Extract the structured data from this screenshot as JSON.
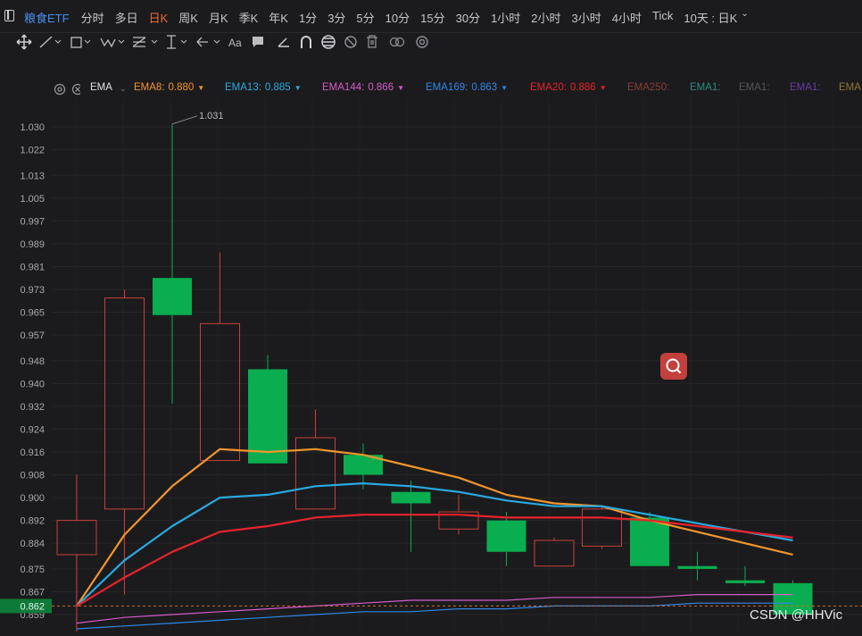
{
  "header": {
    "symbol": "粮食ETF",
    "periods": [
      "分时",
      "多日",
      "日K",
      "周K",
      "月K",
      "季K",
      "年K",
      "1分",
      "3分",
      "5分",
      "10分",
      "15分",
      "30分",
      "1小时",
      "2小时",
      "3小时",
      "4小时",
      "Tick"
    ],
    "active_period": "日K",
    "range_label": "10天 : 日K"
  },
  "toolbar": {
    "icons": [
      "move-icon",
      "line-icon",
      "rect-icon",
      "wave-icon",
      "fib-icon",
      "vertical-ruler-icon",
      "arrow-icon",
      "text-icon",
      "comment-icon",
      "angle-icon",
      "magnet-icon",
      "eye-icon",
      "hide-icon",
      "trash-icon",
      "link-icon",
      "settings-icon"
    ],
    "text_tool_label": "Aa"
  },
  "indicator_legend": {
    "name": "EMA",
    "items": [
      {
        "label": "EMA8:",
        "value": "0.880",
        "color": "#f2952d",
        "has_arrow": true
      },
      {
        "label": "EMA13:",
        "value": "0.885",
        "color": "#2aa9e0",
        "has_arrow": true
      },
      {
        "label": "EMA144:",
        "value": "0.866",
        "color": "#d65bc9",
        "has_arrow": true
      },
      {
        "label": "EMA169:",
        "value": "0.863",
        "color": "#2f86e8",
        "has_arrow": true
      },
      {
        "label": "EMA20:",
        "value": "0.886",
        "color": "#e8232b",
        "has_arrow": true
      },
      {
        "label": "EMA250:",
        "value": "",
        "color": "#8a3a36",
        "has_arrow": false
      },
      {
        "label": "EMA1:",
        "value": "",
        "color": "#2e8a86",
        "has_arrow": false
      },
      {
        "label": "EMA1:",
        "value": "",
        "color": "#55555a",
        "has_arrow": false
      },
      {
        "label": "EMA1:",
        "value": "",
        "color": "#6a3aa8",
        "has_arrow": false
      },
      {
        "label": "EMA1:",
        "value": "",
        "color": "#8a7a2e",
        "has_arrow": false
      }
    ]
  },
  "chart_data": {
    "type": "candlestick",
    "y_ticks": [
      1.03,
      1.022,
      1.013,
      1.005,
      0.997,
      0.989,
      0.981,
      0.973,
      0.965,
      0.957,
      0.948,
      0.94,
      0.932,
      0.924,
      0.916,
      0.908,
      0.9,
      0.892,
      0.884,
      0.875,
      0.867,
      0.859
    ],
    "y_tick_labels": [
      "1.030",
      "1.022",
      "1.013",
      "1.005",
      "0.997",
      "0.989",
      "0.981",
      "0.973",
      "0.965",
      "0.957",
      "0.948",
      "0.940",
      "0.932",
      "0.924",
      "0.916",
      "0.908",
      "0.900",
      "0.892",
      "0.884",
      "0.875",
      "0.867",
      "0.859"
    ],
    "current_price_label": "0.862",
    "current_price": 0.862,
    "high_annotation": "1.031",
    "candles": [
      {
        "open": 0.88,
        "close": 0.892,
        "high": 0.908,
        "low": 0.847
      },
      {
        "open": 0.896,
        "close": 0.97,
        "high": 0.973,
        "low": 0.866
      },
      {
        "open": 0.977,
        "close": 0.964,
        "high": 1.031,
        "low": 0.933
      },
      {
        "open": 0.913,
        "close": 0.961,
        "high": 0.986,
        "low": 0.913
      },
      {
        "open": 0.945,
        "close": 0.912,
        "high": 0.95,
        "low": 0.912
      },
      {
        "open": 0.896,
        "close": 0.921,
        "high": 0.931,
        "low": 0.896
      },
      {
        "open": 0.915,
        "close": 0.908,
        "high": 0.919,
        "low": 0.903
      },
      {
        "open": 0.902,
        "close": 0.898,
        "high": 0.906,
        "low": 0.881
      },
      {
        "open": 0.889,
        "close": 0.895,
        "high": 0.901,
        "low": 0.887
      },
      {
        "open": 0.892,
        "close": 0.881,
        "high": 0.895,
        "low": 0.876
      },
      {
        "open": 0.876,
        "close": 0.885,
        "high": 0.886,
        "low": 0.876
      },
      {
        "open": 0.883,
        "close": 0.896,
        "high": 0.897,
        "low": 0.882
      },
      {
        "open": 0.893,
        "close": 0.876,
        "high": 0.895,
        "low": 0.876
      },
      {
        "open": 0.876,
        "close": 0.875,
        "high": 0.881,
        "low": 0.871
      },
      {
        "open": 0.871,
        "close": 0.87,
        "high": 0.876,
        "low": 0.869
      },
      {
        "open": 0.87,
        "close": 0.859,
        "high": 0.871,
        "low": 0.859
      }
    ],
    "series": [
      {
        "name": "EMA8",
        "color": "#f2952d",
        "values": [
          0.862,
          0.887,
          0.904,
          0.917,
          0.916,
          0.917,
          0.915,
          0.911,
          0.907,
          0.901,
          0.898,
          0.897,
          0.892,
          0.888,
          0.884,
          0.88
        ]
      },
      {
        "name": "EMA13",
        "color": "#2aa9e0",
        "values": [
          0.862,
          0.878,
          0.89,
          0.9,
          0.901,
          0.904,
          0.905,
          0.904,
          0.902,
          0.899,
          0.897,
          0.897,
          0.894,
          0.891,
          0.888,
          0.885
        ]
      },
      {
        "name": "EMA20",
        "color": "#e8232b",
        "values": [
          0.862,
          0.872,
          0.881,
          0.888,
          0.89,
          0.893,
          0.894,
          0.894,
          0.894,
          0.893,
          0.893,
          0.893,
          0.892,
          0.89,
          0.888,
          0.886
        ]
      },
      {
        "name": "EMA144",
        "color": "#d65bc9",
        "values": [
          0.856,
          0.858,
          0.859,
          0.86,
          0.861,
          0.862,
          0.863,
          0.864,
          0.864,
          0.864,
          0.865,
          0.865,
          0.865,
          0.866,
          0.866,
          0.866
        ]
      },
      {
        "name": "EMA169",
        "color": "#2f86e8",
        "values": [
          0.854,
          0.855,
          0.856,
          0.857,
          0.858,
          0.859,
          0.86,
          0.86,
          0.861,
          0.861,
          0.862,
          0.862,
          0.862,
          0.863,
          0.863,
          0.863
        ]
      }
    ]
  },
  "watermark": "CSDN @HHVic"
}
